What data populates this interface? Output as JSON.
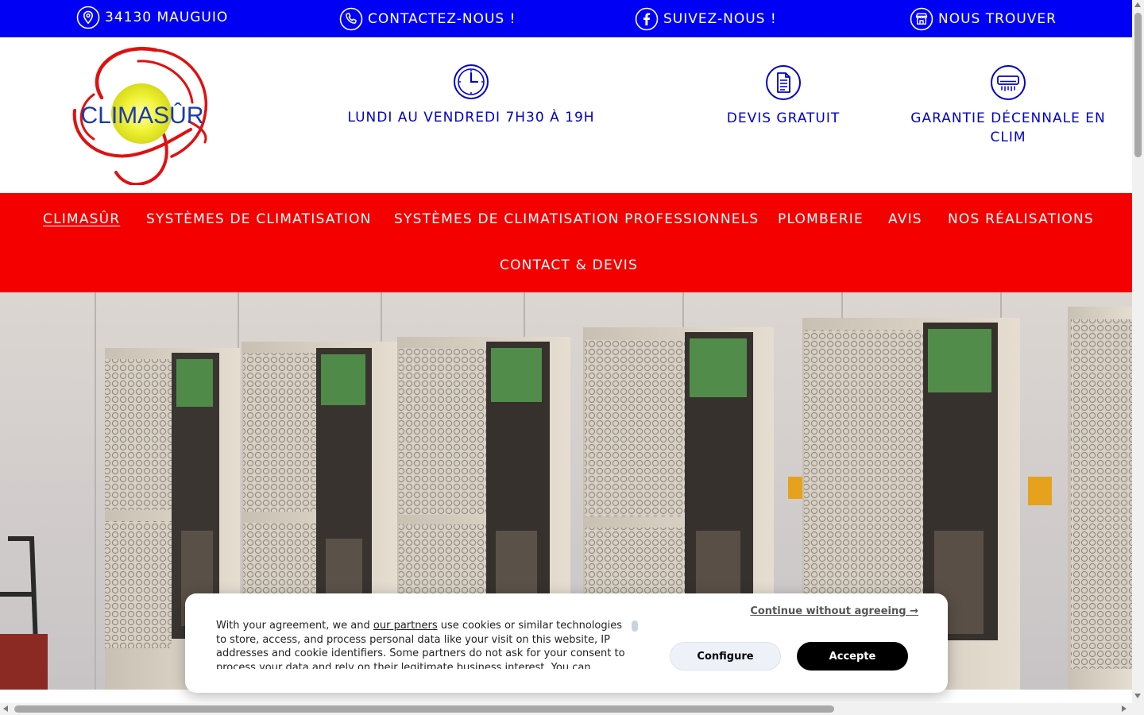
{
  "colors": {
    "topbar_bg": "#0000f5",
    "nav_bg": "#f50000",
    "feature_text": "#0000cc",
    "accept_bg": "#000000"
  },
  "topbar": {
    "items": [
      {
        "icon": "location-pin-icon",
        "label": "34130 MAUGUIO"
      },
      {
        "icon": "phone-icon",
        "label": "CONTACTEZ-NOUS !"
      },
      {
        "icon": "facebook-icon",
        "label": "SUIVEZ-NOUS !"
      },
      {
        "icon": "store-icon",
        "label": "NOUS TROUVER"
      }
    ]
  },
  "header": {
    "logo_text": "CLIMASÛR",
    "features": [
      {
        "icon": "clock-icon",
        "label": "LUNDI AU VENDREDI 7H30 À 19H"
      },
      {
        "icon": "document-icon",
        "label": "DEVIS GRATUIT"
      },
      {
        "icon": "air-conditioner-icon",
        "label": "GARANTIE DÉCENNALE EN CLIM"
      }
    ]
  },
  "nav": {
    "items": [
      {
        "label": "CLIMASÛR",
        "active": true
      },
      {
        "label": "SYSTÈMES DE CLIMATISATION"
      },
      {
        "label": "SYSTÈMES DE CLIMATISATION PROFESSIONNELS"
      },
      {
        "label": "PLOMBERIE"
      },
      {
        "label": "AVIS"
      },
      {
        "label": "NOS RÉALISATIONS"
      },
      {
        "label": "CONTACT & DEVIS"
      }
    ]
  },
  "cookie": {
    "text_before_link": "With your agreement, we and ",
    "link_text": "our partners",
    "text_after_link": " use cookies or similar technologies to store, access, and process personal data like your visit on this website, IP addresses and cookie identifiers. Some partners do not ask for your consent to process your data and rely on their legitimate business interest. You can",
    "continue_label": "Continue without agreeing →",
    "configure_label": "Configure",
    "accept_label": "Accepte"
  }
}
